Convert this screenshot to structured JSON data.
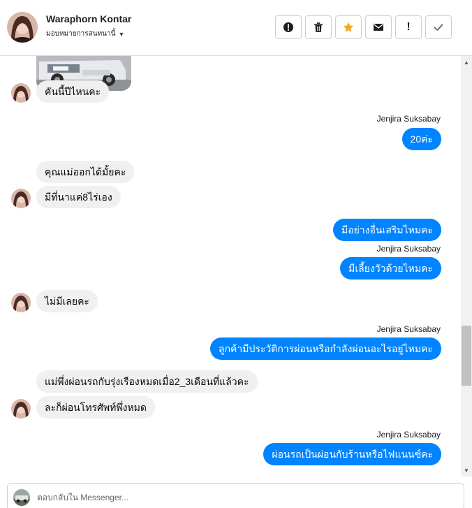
{
  "header": {
    "contact_name": "Waraphorn Kontar",
    "assign_label": "มอบหมายการสนทนานี้",
    "actions": [
      {
        "icon": "alert-circle-icon",
        "label": "!"
      },
      {
        "icon": "trash-icon",
        "label": ""
      },
      {
        "icon": "star-icon",
        "label": ""
      },
      {
        "icon": "envelope-icon",
        "label": ""
      },
      {
        "icon": "exclamation-icon",
        "label": "!"
      },
      {
        "icon": "check-icon",
        "label": ""
      }
    ]
  },
  "messages": {
    "m1": "คันนี้ปีไหนคะ",
    "s1": "Jenjira Suksabay",
    "m2": "20ค่ะ",
    "m3": "คุณแม่ออกได้มั้ยคะ",
    "m4": "มีที่นาแค่8ไร่เอง",
    "m5": "มีอย่างอื่นเสริมไหมคะ",
    "s2": "Jenjira Suksabay",
    "m6": "มีเลี้ยงวัวด้วยไหมคะ",
    "m7": "ไม่มีเลยคะ",
    "s3": "Jenjira Suksabay",
    "m8": "ลูกค้ามีประวัติการผ่อนหรือกำลังผ่อนอะไรอยู่ไหมคะ",
    "m9": "แม่พึ่งผ่อนรถกับรุ่งเรืองหมดเมื่อ2_3เดือนที่แล้วคะ",
    "m10": "ละก็ผ่อนโทรศัพท์พึ่งหมด",
    "s4": "Jenjira Suksabay",
    "m11": "ผ่อนรถเป็นผ่อนกับร้านหรือไฟแนนซ์คะ"
  },
  "composer": {
    "placeholder": "ตอบกลับใน Messenger..."
  },
  "colors": {
    "outgoing_bubble": "#0084ff",
    "incoming_bubble": "#f0f0f0",
    "star": "#f5a623"
  }
}
